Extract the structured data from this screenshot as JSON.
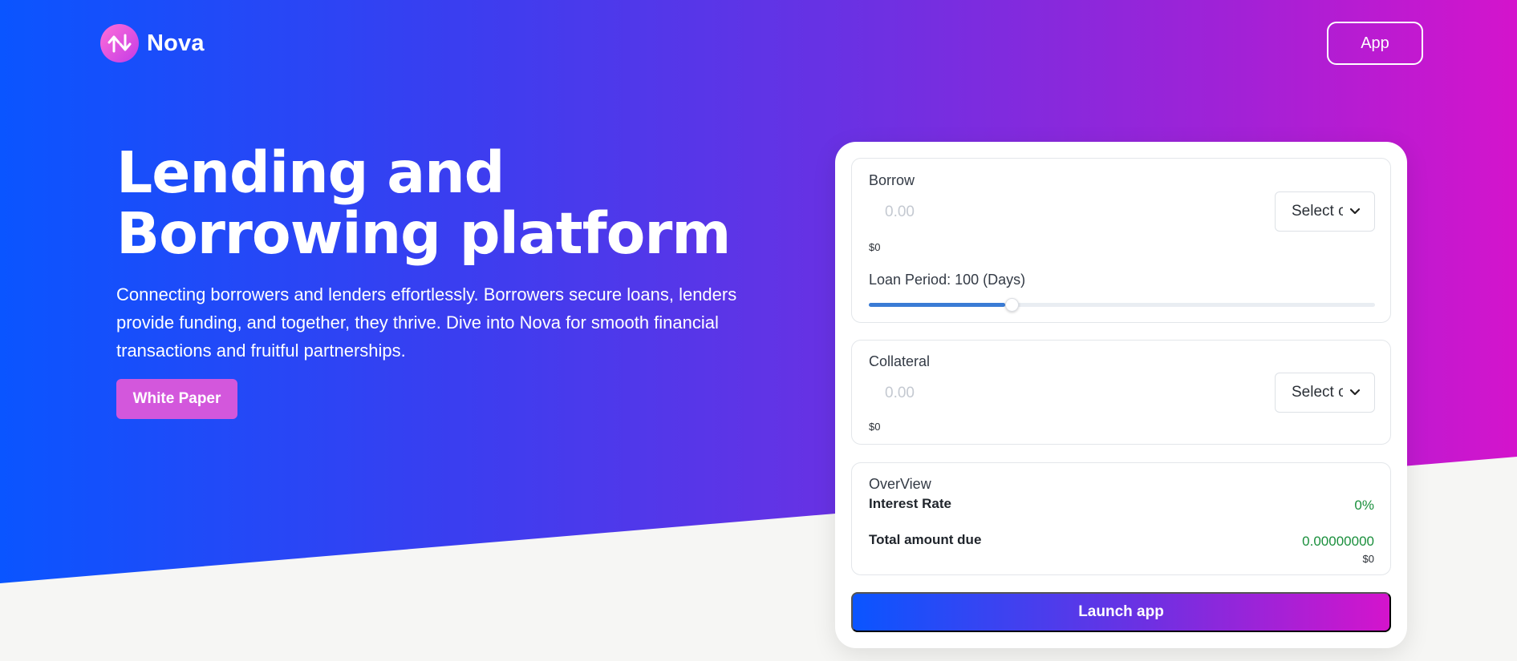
{
  "brand": {
    "name": "Nova"
  },
  "nav": {
    "app_button": "App"
  },
  "hero": {
    "title_line1": "Lending and",
    "title_line2": "Borrowing platform",
    "description": "Connecting borrowers and lenders effortlessly. Borrowers secure loans, lenders provide funding, and together, they thrive. Dive into Nova for smooth financial transactions and fruitful partnerships.",
    "white_paper_button": "White Paper"
  },
  "borrow": {
    "label": "Borrow",
    "amount_placeholder": "0.00",
    "select_label": "Select coin",
    "usd_value": "$0",
    "loan_period_text": "Loan Period: 100 (Days)",
    "loan_period_fraction": 0.27
  },
  "collateral": {
    "label": "Collateral",
    "amount_placeholder": "0.00",
    "select_label": "Select coin",
    "usd_value": "$0"
  },
  "overview": {
    "title": "OverView",
    "interest_rate_label": "Interest Rate",
    "interest_rate_value": "0%",
    "total_due_label": "Total amount due",
    "total_due_value": "0.00000000",
    "total_due_usd": "$0"
  },
  "launch_button": "Launch app",
  "colors": {
    "gradient_start": "#0a55ff",
    "gradient_end": "#d414cc",
    "accent_pink": "#d357dc",
    "value_green": "#1a8f3c",
    "slider_blue": "#3a7bd5"
  }
}
